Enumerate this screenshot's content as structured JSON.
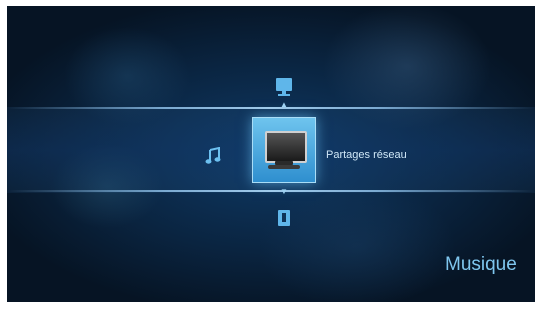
{
  "menu": {
    "selected_item": {
      "label": "Partages réseau",
      "icon": "monitor-icon"
    },
    "previous_item": {
      "icon": "display-icon"
    },
    "next_item": {
      "icon": "usb-drive-icon"
    },
    "left_item": {
      "icon": "music-note-icon"
    }
  },
  "section": {
    "title": "Musique"
  },
  "colors": {
    "accent": "#7fc6ee",
    "selector": "#4aa8e0",
    "background": "#0a2440"
  }
}
